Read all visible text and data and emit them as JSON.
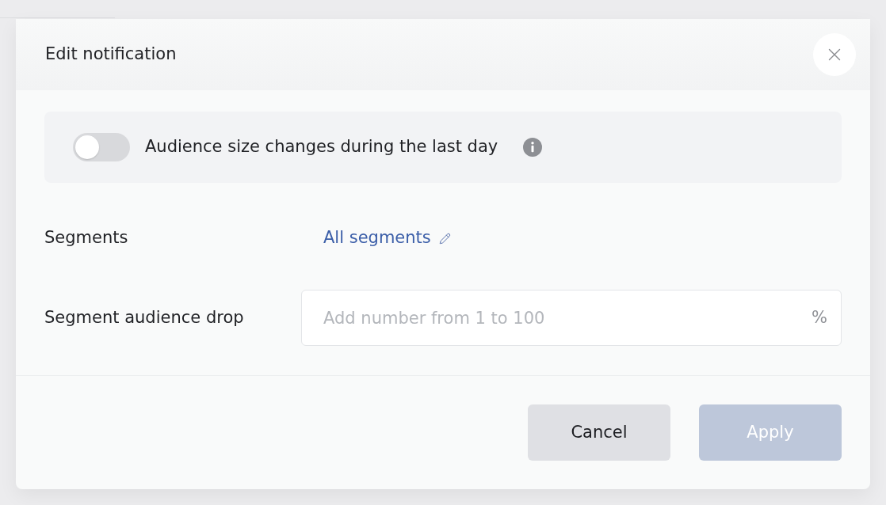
{
  "dialog": {
    "title": "Edit notification"
  },
  "audience_alert": {
    "label": "Audience size changes during the last day",
    "on": false
  },
  "fields": [
    {
      "kind": "link",
      "label": "Segments",
      "value": "All segments"
    },
    {
      "kind": "input",
      "label": "Segment audience drop",
      "placeholder": "Add number from 1 to 100",
      "suffix": "%"
    }
  ],
  "buttons": [
    {
      "label": "Cancel",
      "kind": "secondary",
      "disabled": false
    },
    {
      "label": "Apply",
      "kind": "primary",
      "disabled": true
    }
  ]
}
